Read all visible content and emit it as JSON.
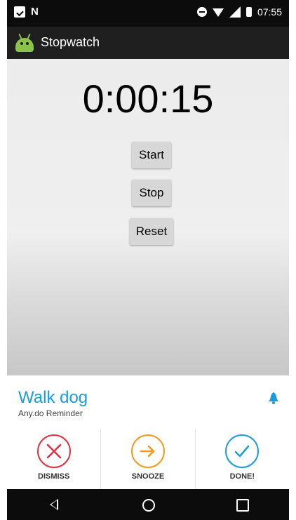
{
  "status": {
    "time": "07:55",
    "icons": [
      "check-box-icon",
      "n-icon",
      "do-not-disturb-icon",
      "wifi-icon",
      "signal-icon",
      "battery-icon"
    ]
  },
  "app": {
    "title": "Stopwatch",
    "icon": "android-icon"
  },
  "timer": {
    "display": "0:00:15"
  },
  "buttons": {
    "start": "Start",
    "stop": "Stop",
    "reset": "Reset"
  },
  "notification": {
    "title": "Walk dog",
    "subtitle": "Any.do Reminder",
    "icon": "bell-icon",
    "actions": [
      {
        "label": "DISMISS",
        "icon": "x-icon",
        "color": "#e03142"
      },
      {
        "label": "SNOOZE",
        "icon": "arrow-right-icon",
        "color": "#f39a1c"
      },
      {
        "label": "DONE!",
        "icon": "check-icon",
        "color": "#1a9ddb"
      }
    ]
  },
  "navbar": {
    "buttons": [
      "back-icon",
      "home-icon",
      "recent-apps-icon"
    ]
  },
  "colors": {
    "accent": "#1a9ddb",
    "android_green": "#8bc34a",
    "dismiss": "#e03142",
    "snooze": "#f39a1c",
    "done": "#1a9ddb"
  }
}
